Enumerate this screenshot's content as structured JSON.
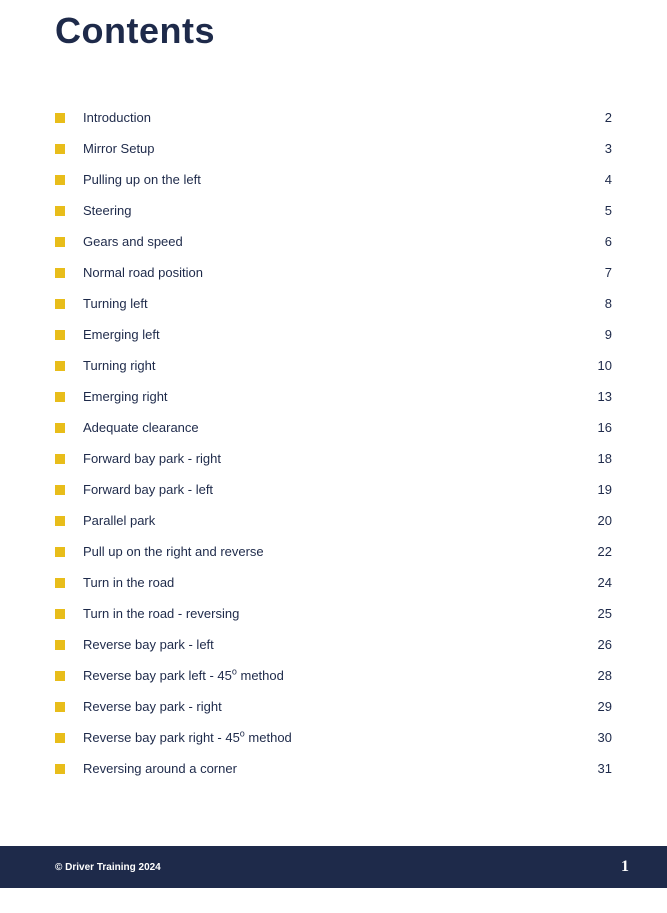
{
  "title": "Contents",
  "toc": [
    {
      "label": "Introduction",
      "page": "2"
    },
    {
      "label": "Mirror Setup",
      "page": "3"
    },
    {
      "label": "Pulling up on the left",
      "page": "4"
    },
    {
      "label": "Steering",
      "page": "5"
    },
    {
      "label": "Gears and speed",
      "page": "6"
    },
    {
      "label": "Normal road position",
      "page": "7"
    },
    {
      "label": "Turning left",
      "page": "8"
    },
    {
      "label": "Emerging left",
      "page": "9"
    },
    {
      "label": "Turning right",
      "page": "10"
    },
    {
      "label": "Emerging right",
      "page": "13"
    },
    {
      "label": "Adequate clearance",
      "page": "16"
    },
    {
      "label": "Forward bay park - right",
      "page": "18"
    },
    {
      "label": "Forward bay park - left",
      "page": "19"
    },
    {
      "label": "Parallel park",
      "page": "20"
    },
    {
      "label": "Pull up on the right and reverse",
      "page": "22"
    },
    {
      "label": "Turn in the road",
      "page": "24"
    },
    {
      "label": "Turn in the road - reversing",
      "page": "25"
    },
    {
      "label": "Reverse bay park - left",
      "page": "26"
    },
    {
      "label_html": "Reverse bay park left - 45<sup>o</sup> method",
      "page": "28"
    },
    {
      "label": "Reverse bay park - right",
      "page": "29"
    },
    {
      "label_html": "Reverse bay park right - 45<sup>o</sup> method",
      "page": "30"
    },
    {
      "label": "Reversing around a corner",
      "page": "31"
    }
  ],
  "footer": {
    "copyright": "© Driver Training 2024",
    "page_number": "1"
  }
}
